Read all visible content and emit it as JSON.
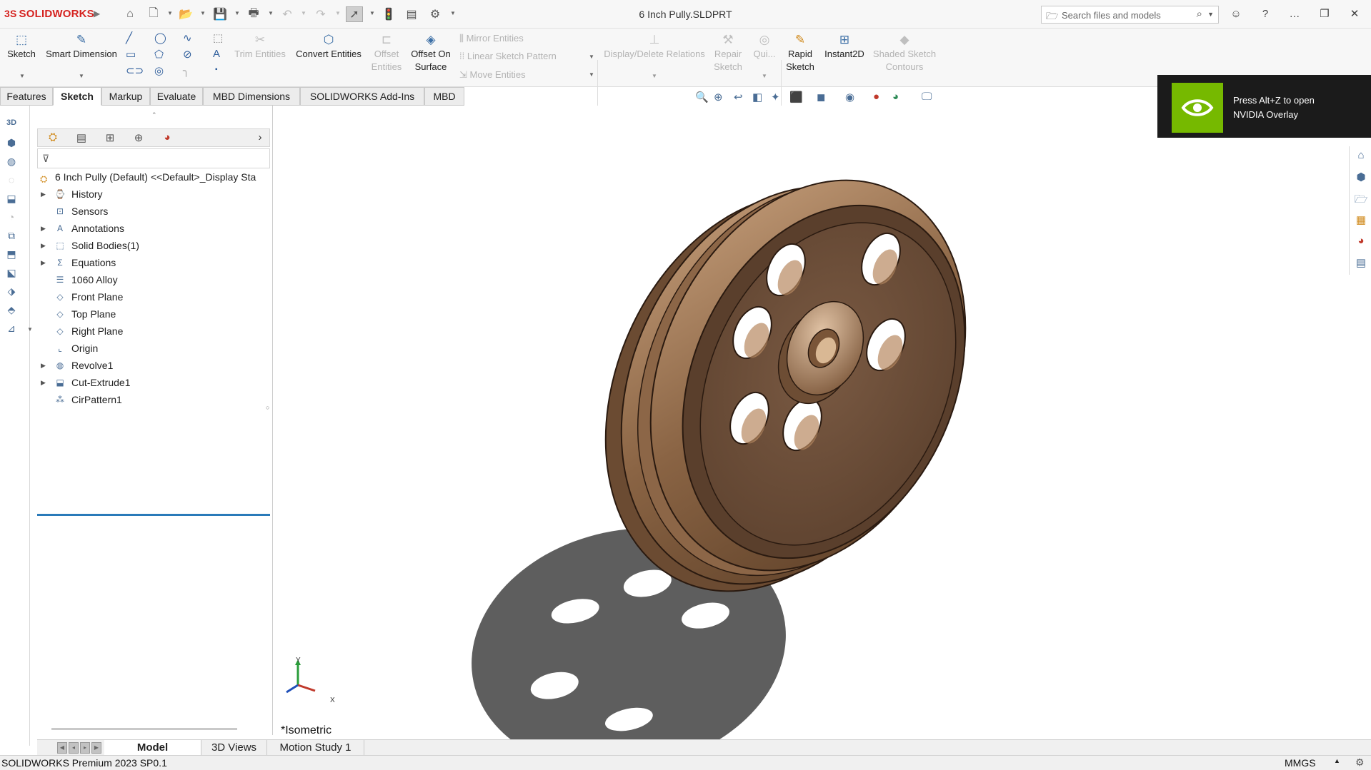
{
  "app": {
    "logo_text": "SOLIDWORKS",
    "logo_mark": "3S",
    "document_title": "6 Inch Pully.SLDPRT"
  },
  "search": {
    "placeholder": "Search files and models"
  },
  "ribbon": {
    "sketch": "Sketch",
    "smart_dimension": "Smart Dimension",
    "trim_entities": "Trim Entities",
    "convert_entities": "Convert Entities",
    "offset_entities_1": "Offset",
    "offset_entities_2": "Entities",
    "offset_on_surface_1": "Offset On",
    "offset_on_surface_2": "Surface",
    "mirror_entities": "Mirror Entities",
    "linear_sketch_pattern": "Linear Sketch Pattern",
    "move_entities": "Move Entities",
    "display_delete_relations": "Display/Delete Relations",
    "repair_sketch_1": "Repair",
    "repair_sketch_2": "Sketch",
    "quick_snaps": "Qui...",
    "rapid_sketch_1": "Rapid",
    "rapid_sketch_2": "Sketch",
    "instant2d": "Instant2D",
    "shaded_sketch_1": "Shaded Sketch",
    "shaded_sketch_2": "Contours"
  },
  "tabs": [
    "Features",
    "Sketch",
    "Markup",
    "Evaluate",
    "MBD Dimensions",
    "SOLIDWORKS Add-Ins",
    "MBD"
  ],
  "tree": {
    "root": "6 Inch Pully (Default) <<Default>_Display Sta",
    "items": [
      {
        "label": "History",
        "icon": "history-icon",
        "expandable": true
      },
      {
        "label": "Sensors",
        "icon": "sensors-icon",
        "expandable": false
      },
      {
        "label": "Annotations",
        "icon": "annotations-icon",
        "expandable": true
      },
      {
        "label": "Solid Bodies(1)",
        "icon": "solid-bodies-icon",
        "expandable": true
      },
      {
        "label": "Equations",
        "icon": "equations-icon",
        "expandable": true
      },
      {
        "label": "1060 Alloy",
        "icon": "material-icon",
        "expandable": false
      },
      {
        "label": "Front Plane",
        "icon": "plane-icon",
        "expandable": false
      },
      {
        "label": "Top Plane",
        "icon": "plane-icon",
        "expandable": false
      },
      {
        "label": "Right Plane",
        "icon": "plane-icon",
        "expandable": false
      },
      {
        "label": "Origin",
        "icon": "origin-icon",
        "expandable": false
      },
      {
        "label": "Revolve1",
        "icon": "revolve-icon",
        "expandable": true
      },
      {
        "label": "Cut-Extrude1",
        "icon": "cut-extrude-icon",
        "expandable": true
      },
      {
        "label": "CirPattern1",
        "icon": "circular-pattern-icon",
        "expandable": false
      }
    ]
  },
  "viewport": {
    "view_name": "*Isometric",
    "axis_x": "X",
    "axis_y": "Y"
  },
  "notification": {
    "line1": "Press Alt+Z to open",
    "line2": "NVIDIA Overlay"
  },
  "bottom_tabs": [
    "Model",
    "3D Views",
    "Motion Study 1"
  ],
  "status": {
    "text": "SOLIDWORKS Premium 2023 SP0.1",
    "units": "MMGS"
  },
  "colors": {
    "accent_red": "#d5211e",
    "nvidia_green": "#76b900",
    "selection_blue": "#2a7ab9"
  }
}
